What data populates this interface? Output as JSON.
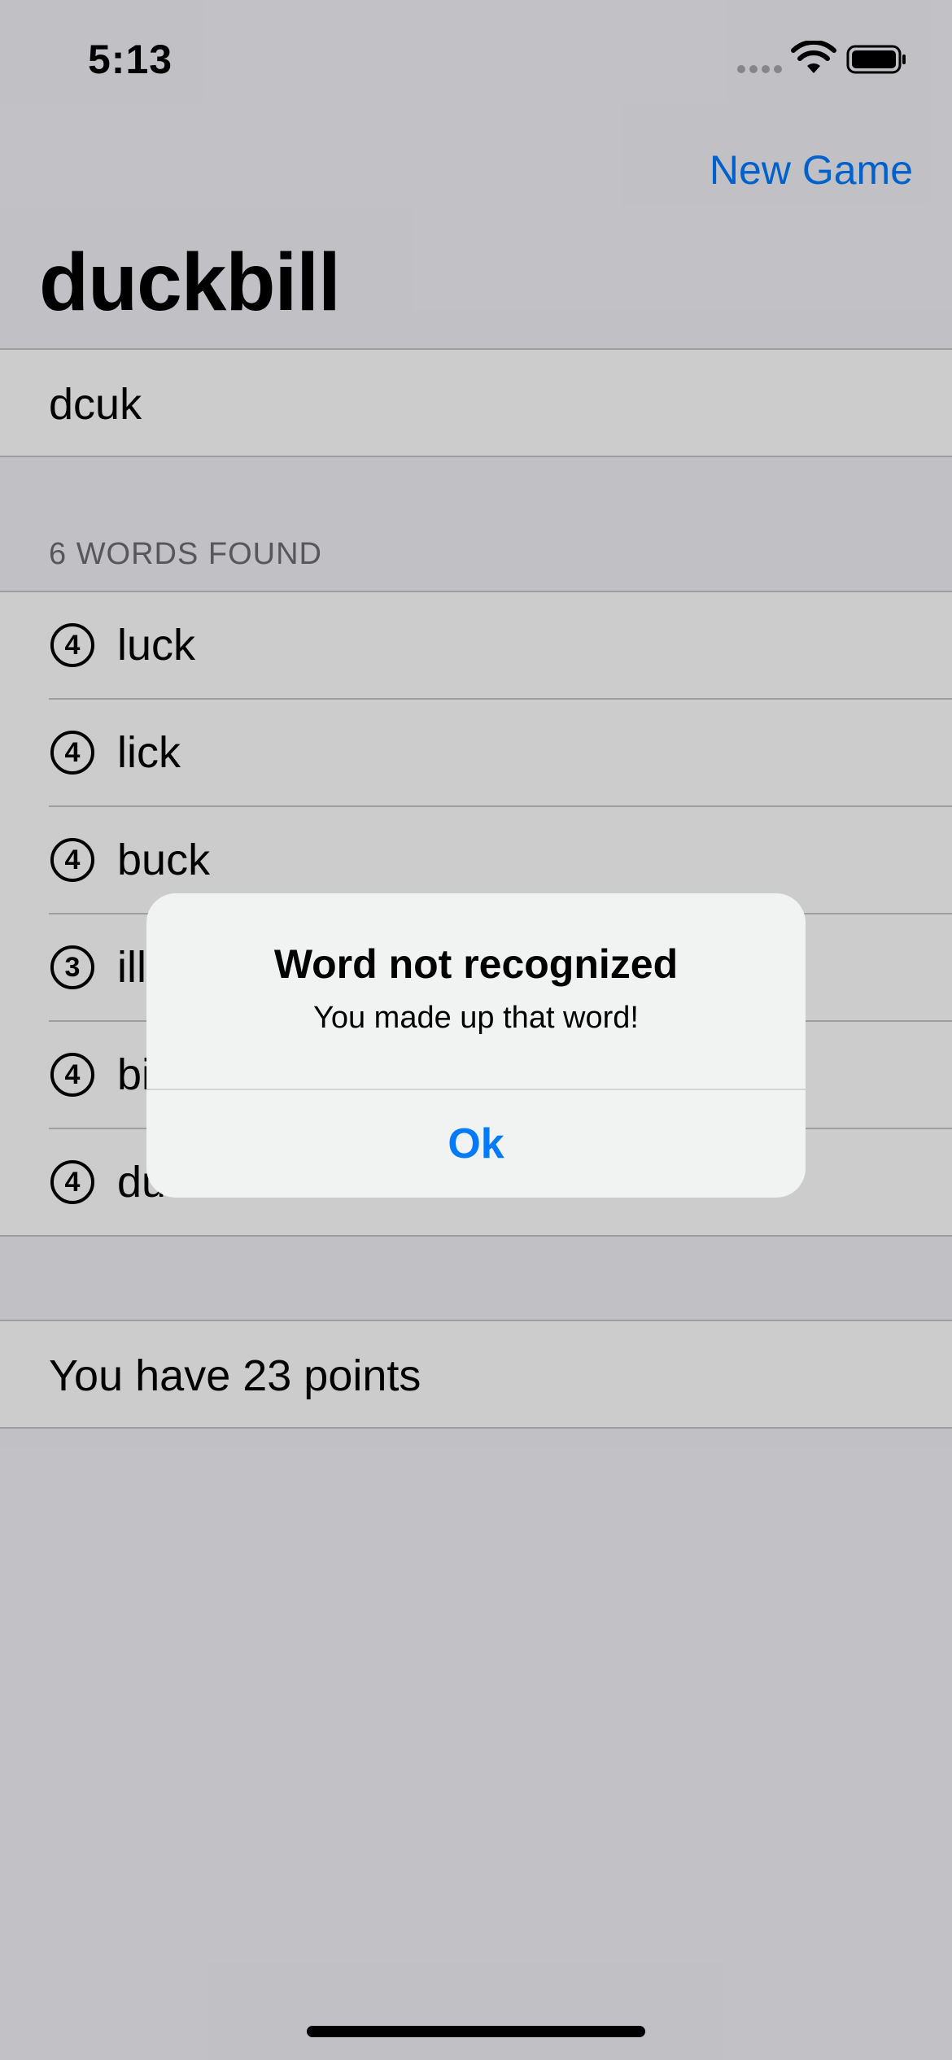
{
  "status_bar": {
    "time": "5:13"
  },
  "nav": {
    "action_label": "New Game",
    "title": "duckbill"
  },
  "input": {
    "value": "dcuk"
  },
  "words_section": {
    "header": "6 WORDS FOUND",
    "items": [
      {
        "score": "4",
        "word": "luck"
      },
      {
        "score": "4",
        "word": "lick"
      },
      {
        "score": "4",
        "word": "buck"
      },
      {
        "score": "3",
        "word": "ill"
      },
      {
        "score": "4",
        "word": "bi"
      },
      {
        "score": "4",
        "word": "du"
      }
    ]
  },
  "score": {
    "text": "You have 23 points"
  },
  "alert": {
    "title": "Word not recognized",
    "message": "You made up that word!",
    "button_label": "Ok"
  },
  "colors": {
    "accent": "#007aff",
    "background": "#f2f2f7",
    "alert_background": "#f1f2f2"
  },
  "icons": [
    "signal-icon",
    "wifi-icon",
    "battery-icon",
    "score-badge-icon"
  ]
}
